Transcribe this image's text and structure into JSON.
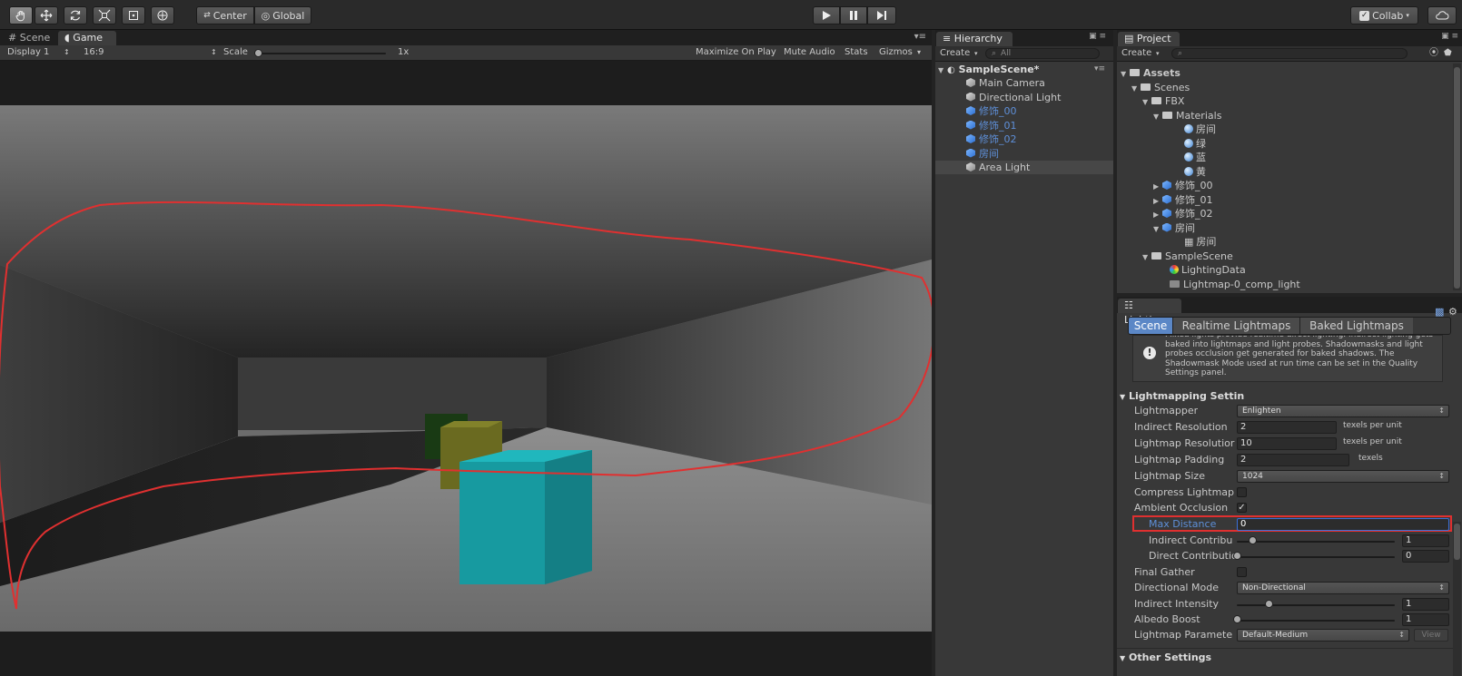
{
  "toolbar": {
    "pivot_label": "Center",
    "space_label": "Global",
    "collab_label": "Collab"
  },
  "scene_tab": "Scene",
  "game_tab": "Game",
  "game_bar": {
    "display": "Display 1",
    "aspect": "16:9",
    "scale_label": "Scale",
    "scale_value": "1x",
    "maximize": "Maximize On Play",
    "mute": "Mute Audio",
    "stats": "Stats",
    "gizmos": "Gizmos"
  },
  "hierarchy": {
    "tab": "Hierarchy",
    "create": "Create",
    "search_placeholder": "All",
    "scene": "SampleScene*",
    "items": [
      {
        "label": "Main Camera",
        "blue": false
      },
      {
        "label": "Directional Light",
        "blue": false
      },
      {
        "label": "修饰_00",
        "blue": true
      },
      {
        "label": "修饰_01",
        "blue": true
      },
      {
        "label": "修饰_02",
        "blue": true
      },
      {
        "label": "房间",
        "blue": true
      },
      {
        "label": "Area Light",
        "blue": false
      }
    ]
  },
  "project": {
    "tab": "Project",
    "create": "Create",
    "tree": [
      {
        "label": "Assets",
        "bold": true
      },
      {
        "label": "Scenes"
      },
      {
        "label": "FBX"
      },
      {
        "label": "Materials"
      },
      {
        "label": "房间"
      },
      {
        "label": "绿"
      },
      {
        "label": "蓝"
      },
      {
        "label": "黄"
      },
      {
        "label": "修饰_00"
      },
      {
        "label": "修饰_01"
      },
      {
        "label": "修饰_02"
      },
      {
        "label": "房间"
      },
      {
        "label": "房间"
      },
      {
        "label": "SampleScene"
      },
      {
        "label": "LightingData"
      },
      {
        "label": "Lightmap-0_comp_light"
      }
    ]
  },
  "lighting": {
    "tab": "Lighting",
    "subtabs": [
      "Scene",
      "Realtime Lightmaps",
      "Baked Lightmaps"
    ],
    "info_text": "Mixed lights provide realtime direct lighting. Indirect lighting gets baked into lightmaps and light probes. Shadowmasks and light probes occlusion get generated for baked shadows. The Shadowmask Mode used at run time can be set in the Quality Settings panel.",
    "section_title": "Lightmapping Settin",
    "other_settings": "Other Settings",
    "fields": {
      "lightmapper": {
        "label": "Lightmapper",
        "value": "Enlighten"
      },
      "indirect_resolution": {
        "label": "Indirect Resolution",
        "value": "2",
        "unit": "texels per unit"
      },
      "lightmap_resolution": {
        "label": "Lightmap Resolutior",
        "value": "10",
        "unit": "texels per unit"
      },
      "lightmap_padding": {
        "label": "Lightmap Padding",
        "value": "2",
        "unit": "texels"
      },
      "lightmap_size": {
        "label": "Lightmap Size",
        "value": "1024"
      },
      "compress": {
        "label": "Compress Lightmap"
      },
      "ambient_occlusion": {
        "label": "Ambient Occlusion"
      },
      "max_distance": {
        "label": "Max Distance",
        "value": "0"
      },
      "indirect_contribution": {
        "label": "Indirect Contribu",
        "value": "1"
      },
      "direct_contribution": {
        "label": "Direct Contributio",
        "value": "0"
      },
      "final_gather": {
        "label": "Final Gather"
      },
      "directional_mode": {
        "label": "Directional Mode",
        "value": "Non-Directional"
      },
      "indirect_intensity": {
        "label": "Indirect Intensity",
        "value": "1"
      },
      "albedo_boost": {
        "label": "Albedo Boost",
        "value": "1"
      },
      "lightmap_parameters": {
        "label": "Lightmap Paramete",
        "value": "Default-Medium",
        "view": "View"
      }
    }
  },
  "colors": {
    "highlight_red": "#e03030",
    "selected_blue": "#3a6fd8",
    "cube_cyan": "#1fa2a8",
    "cube_yellow": "#7a7a24",
    "cube_green": "#1a4a1a"
  }
}
